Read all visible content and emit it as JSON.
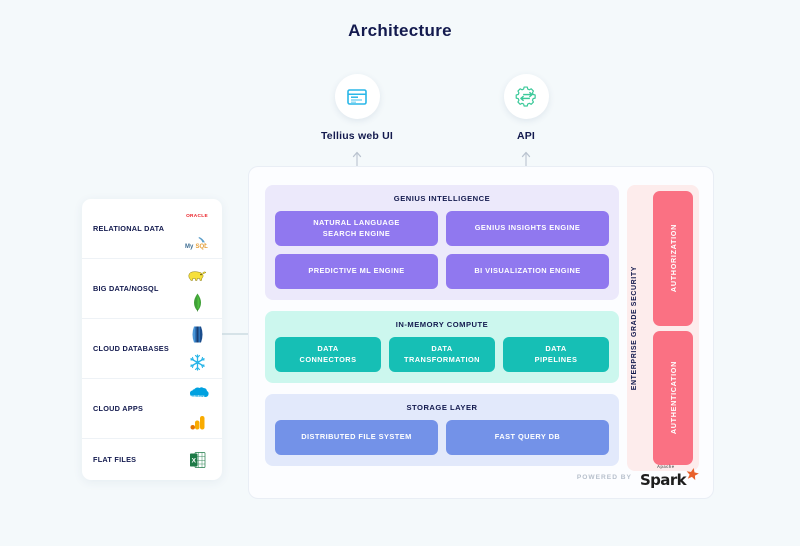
{
  "page": {
    "title": "Architecture",
    "background": "#f4f9fb",
    "title_color": "#131a4e"
  },
  "channels": [
    {
      "id": "tellius-web-ui",
      "label": "Tellius web UI",
      "icon": "browser-window-icon",
      "icon_color": "#2ab7e8"
    },
    {
      "id": "api",
      "label": "API",
      "icon": "gear-arrows-icon",
      "icon_color": "#3cc99a"
    }
  ],
  "data_sources": {
    "rows": [
      {
        "label": "RELATIONAL DATA",
        "logos": [
          "oracle-logo",
          "mysql-logo"
        ]
      },
      {
        "label": "BIG DATA/NOSQL",
        "logos": [
          "hadoop-logo",
          "mongodb-logo"
        ]
      },
      {
        "label": "CLOUD DATABASES",
        "logos": [
          "amazon-redshift-logo",
          "snowflake-logo"
        ]
      },
      {
        "label": "CLOUD APPS",
        "logos": [
          "salesforce-logo",
          "google-analytics-logo"
        ]
      },
      {
        "label": "FLAT FILES",
        "logos": [
          "excel-logo"
        ]
      }
    ]
  },
  "platform": {
    "layers": [
      {
        "id": "genius-intelligence",
        "title": "GENIUS INTELLIGENCE",
        "panel_color": "#ece9fb",
        "node_color": "#9078ef",
        "nodes": [
          "NATURAL LANGUAGE\nSEARCH ENGINE",
          "GENIUS INSIGHTS ENGINE",
          "PREDICTIVE ML ENGINE",
          "BI VISUALIZATION ENGINE"
        ]
      },
      {
        "id": "in-memory-compute",
        "title": "IN-MEMORY COMPUTE",
        "panel_color": "#ccf7ee",
        "node_color": "#16bfb5",
        "nodes": [
          "DATA\nCONNECTORS",
          "DATA\nTRANSFORMATION",
          "DATA\nPIPELINES"
        ]
      },
      {
        "id": "storage-layer",
        "title": "STORAGE LAYER",
        "panel_color": "#e2e9fb",
        "node_color": "#7392e8",
        "nodes": [
          "DISTRIBUTED FILE SYSTEM",
          "FAST QUERY DB"
        ]
      }
    ],
    "security": {
      "title": "ENTERPRISE GRADE SECURITY",
      "panel_color": "#fdecec",
      "node_color": "#fa7183",
      "nodes": [
        "AUTHORIZATION",
        "AUTHENTICATION"
      ]
    },
    "powered_by": {
      "label": "POWERED BY",
      "product_apache": "Apache",
      "product_name": "Spark",
      "star_color": "#e8612c"
    }
  }
}
